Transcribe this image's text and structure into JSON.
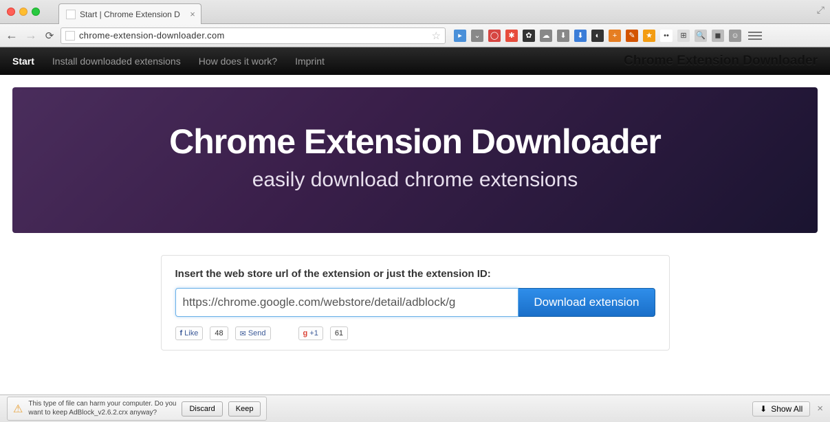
{
  "browser": {
    "tab_title": "Start | Chrome Extension D",
    "url": "chrome-extension-downloader.com",
    "extension_icons": [
      {
        "bg": "#4a90d9",
        "char": "▸"
      },
      {
        "bg": "#888",
        "char": "⌄"
      },
      {
        "bg": "#d64541",
        "char": "◯"
      },
      {
        "bg": "#e74c3c",
        "char": "✱"
      },
      {
        "bg": "#333",
        "char": "✿"
      },
      {
        "bg": "#888",
        "char": "☁"
      },
      {
        "bg": "#888",
        "char": "⬇"
      },
      {
        "bg": "#3b7dd8",
        "char": "⬇"
      },
      {
        "bg": "#333",
        "char": "◐"
      },
      {
        "bg": "#e67e22",
        "char": "+"
      },
      {
        "bg": "#d35400",
        "char": "✎"
      },
      {
        "bg": "#f39c12",
        "char": "★"
      },
      {
        "bg": "#fff",
        "char": "••"
      },
      {
        "bg": "#ddd",
        "char": "⊞"
      },
      {
        "bg": "#ccc",
        "char": "🔍"
      },
      {
        "bg": "#bbb",
        "char": "◼"
      },
      {
        "bg": "#999",
        "char": "☺"
      }
    ]
  },
  "nav": {
    "items": [
      "Start",
      "Install downloaded extensions",
      "How does it work?",
      "Imprint"
    ],
    "active_index": 0,
    "brand": "Chrome Extension Downloader"
  },
  "hero": {
    "title": "Chrome Extension Downloader",
    "subtitle": "easily download chrome extensions"
  },
  "form": {
    "label": "Insert the web store url of the extension or just the extension ID:",
    "input_value": "https://chrome.google.com/webstore/detail/adblock/g",
    "button": "Download extension"
  },
  "social": {
    "like_label": "Like",
    "like_count": "48",
    "send_label": "Send",
    "gplus_label": "+1",
    "gplus_count": "61"
  },
  "download_bar": {
    "warning_line1": "This type of file can harm your computer. Do you",
    "warning_line2": "want to keep AdBlock_v2.6.2.crx anyway?",
    "discard": "Discard",
    "keep": "Keep",
    "show_all": "Show All"
  }
}
